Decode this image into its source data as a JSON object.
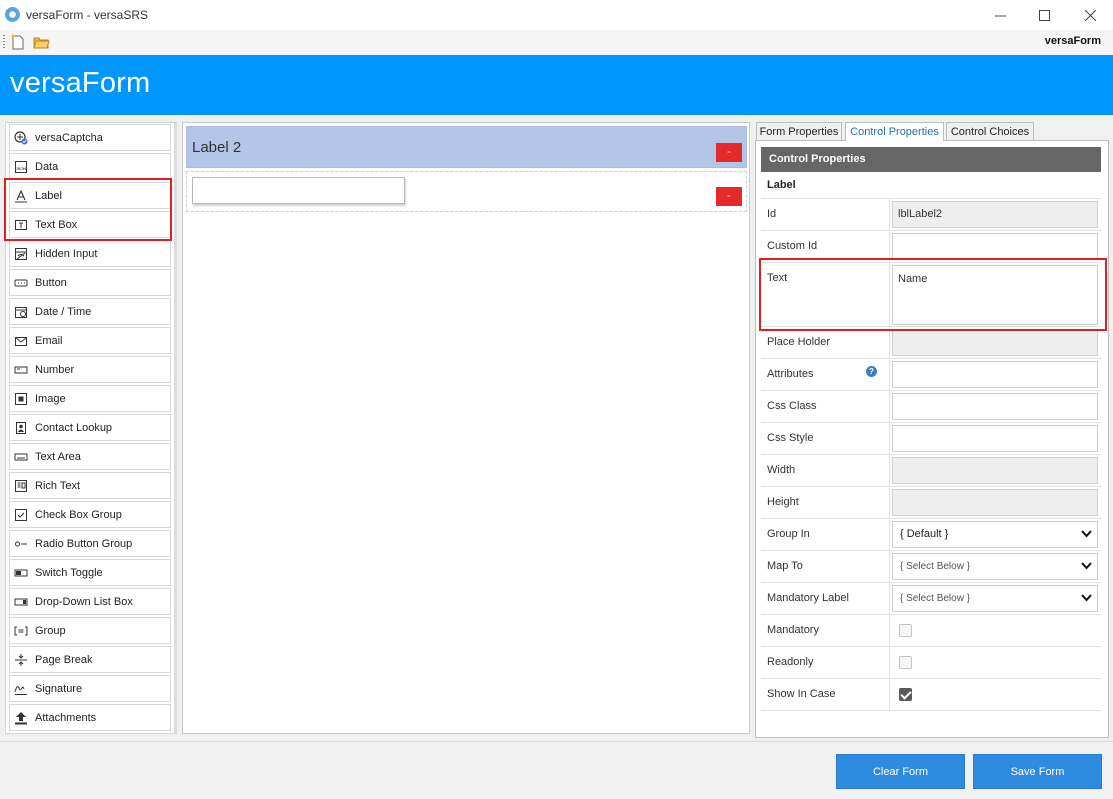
{
  "window": {
    "title": "versaForm - versaSRS"
  },
  "toolbar": {
    "brand": "versaForm"
  },
  "header": {
    "title": "versaForm"
  },
  "toolbox": {
    "items": [
      {
        "label": "versaCaptcha",
        "icon": "captcha-icon"
      },
      {
        "label": "Data",
        "icon": "json-file-icon"
      },
      {
        "label": "Label",
        "icon": "label-icon"
      },
      {
        "label": "Text Box",
        "icon": "textbox-icon"
      },
      {
        "label": "Hidden Input",
        "icon": "hidden-input-icon"
      },
      {
        "label": "Button",
        "icon": "button-icon"
      },
      {
        "label": "Date / Time",
        "icon": "calendar-icon"
      },
      {
        "label": "Email",
        "icon": "envelope-icon"
      },
      {
        "label": "Number",
        "icon": "number-icon"
      },
      {
        "label": "Image",
        "icon": "image-icon"
      },
      {
        "label": "Contact Lookup",
        "icon": "contact-icon"
      },
      {
        "label": "Text Area",
        "icon": "textarea-icon"
      },
      {
        "label": "Rich Text",
        "icon": "richtext-icon"
      },
      {
        "label": "Check Box Group",
        "icon": "checkbox-icon"
      },
      {
        "label": "Radio Button Group",
        "icon": "radio-icon"
      },
      {
        "label": "Switch Toggle",
        "icon": "toggle-icon"
      },
      {
        "label": "Drop-Down List Box",
        "icon": "dropdown-icon"
      },
      {
        "label": "Group",
        "icon": "group-icon"
      },
      {
        "label": "Page Break",
        "icon": "page-break-icon"
      },
      {
        "label": "Signature",
        "icon": "signature-icon"
      },
      {
        "label": "Attachments",
        "icon": "upload-icon"
      }
    ]
  },
  "canvas": {
    "label_control_text": "Label 2",
    "delete_label": "-"
  },
  "tabs": [
    "Form Properties",
    "Control Properties",
    "Control Choices"
  ],
  "properties": {
    "header": "Control Properties",
    "control_type": "Label",
    "rows": {
      "id": {
        "label": "Id",
        "value": "lblLabel2"
      },
      "custom_id": {
        "label": "Custom Id",
        "value": ""
      },
      "text": {
        "label": "Text",
        "value": "Name"
      },
      "place_holder": {
        "label": "Place Holder",
        "value": ""
      },
      "attributes": {
        "label": "Attributes",
        "value": ""
      },
      "css_class": {
        "label": "Css Class",
        "value": ""
      },
      "css_style": {
        "label": "Css Style",
        "value": ""
      },
      "width": {
        "label": "Width",
        "value": ""
      },
      "height": {
        "label": "Height",
        "value": ""
      },
      "group_in": {
        "label": "Group In",
        "value": "{ Default }"
      },
      "map_to": {
        "label": "Map To",
        "value": "{ Select Below }"
      },
      "mandatory_label": {
        "label": "Mandatory Label",
        "value": "{ Select Below }"
      },
      "mandatory": {
        "label": "Mandatory",
        "checked": false
      },
      "readonly": {
        "label": "Readonly",
        "checked": false
      },
      "show_in_case": {
        "label": "Show In Case",
        "checked": true
      }
    },
    "help_glyph": "?"
  },
  "actions": {
    "clear": "Clear Form",
    "save": "Save Form"
  },
  "colors": {
    "header": "#0096ff",
    "button": "#2f8be0",
    "delete": "#e62a2a",
    "highlight": "#e02020",
    "label_row": "#b3c6e7"
  }
}
